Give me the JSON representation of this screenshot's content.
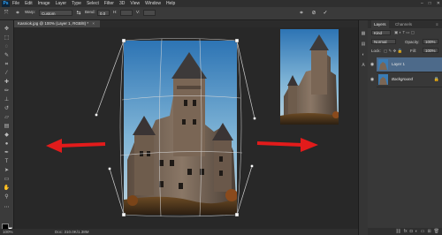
{
  "app": {
    "logo": "Ps"
  },
  "menu": [
    "File",
    "Edit",
    "Image",
    "Layer",
    "Type",
    "Select",
    "Filter",
    "3D",
    "View",
    "Window",
    "Help"
  ],
  "window_controls": [
    "–",
    "□",
    "✕"
  ],
  "options_bar": {
    "warp_label": "Warp:",
    "warp_value": "Custom",
    "bend_label": "Bend:",
    "bend_value": "0.0",
    "h_label": "H:",
    "h_value": "",
    "v_label": "V:",
    "v_value": "",
    "cancel_icon": "cancel-icon",
    "commit_icon": "commit-icon"
  },
  "document_tab": {
    "title": "Kasniok.jpg @ 100% (Layer 1, RGB/8) *",
    "close": "×"
  },
  "statusbar": {
    "zoom": "100%",
    "doc": "Doc: 310.0K/1.38M"
  },
  "panel": {
    "tabs": [
      "Layers",
      "Channels"
    ],
    "kind_label": "Kind",
    "blend_mode": "Normal",
    "opacity_label": "Opacity:",
    "opacity_value": "100%",
    "lock_label": "Lock:",
    "fill_label": "Fill:",
    "fill_value": "100%",
    "layers": [
      {
        "name": "Layer 1",
        "selected": true
      },
      {
        "name": "Background",
        "selected": false
      }
    ]
  },
  "colors": {
    "arrow": "#e21b1b",
    "sky": "#3a7cb5",
    "selected_layer": "#4d6a8a"
  }
}
